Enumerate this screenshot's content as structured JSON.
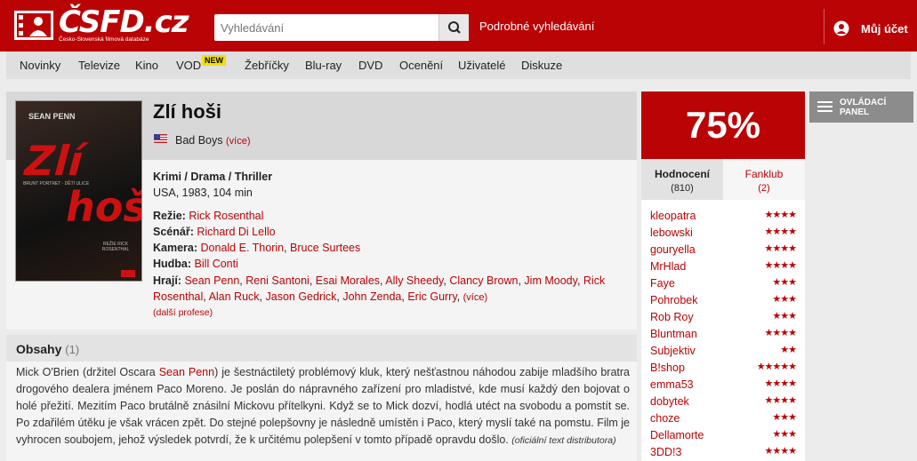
{
  "header": {
    "logo_text": "ČSFD.cz",
    "logo_sub": "Česko-Slovenská filmová databáze",
    "search_placeholder": "Vyhledávání",
    "advanced_search": "Podrobné vyhledávání",
    "account": "Můj účet"
  },
  "nav": {
    "items": [
      "Novinky",
      "Televize",
      "Kino",
      "VOD",
      "Žebříčky",
      "Blu-ray",
      "DVD",
      "Ocenění",
      "Uživatelé",
      "Diskuze"
    ],
    "new_badge": "NEW"
  },
  "film": {
    "poster": {
      "top": "SEAN PENN",
      "title1": "Zlí",
      "title2": "hoši",
      "tagline": "BRUNT PORTRET · DĚTÍ ULICE",
      "credit": "REŽIE RICK ROSENTHAL"
    },
    "title": "Zlí hoši",
    "original_title": "Bad Boys",
    "more": "(více)",
    "genres": "Krimi / Drama / Thriller",
    "origin": "USA, 1983, 104 min",
    "credits": [
      {
        "role": "Režie:",
        "names": [
          "Rick Rosenthal"
        ]
      },
      {
        "role": "Scénář:",
        "names": [
          "Richard Di Lello"
        ]
      },
      {
        "role": "Kamera:",
        "names": [
          "Donald E. Thorin",
          "Bruce Surtees"
        ]
      },
      {
        "role": "Hudba:",
        "names": [
          "Bill Conti"
        ]
      }
    ],
    "cast_label": "Hrají:",
    "cast": [
      "Sean Penn",
      "Reni Santoni",
      "Esai Morales",
      "Ally Sheedy",
      "Clancy Brown",
      "Jim Moody",
      "Rick Rosenthal",
      "Alan Ruck",
      "Jason Gedrick",
      "John Zenda",
      "Eric Gurry"
    ],
    "cast_more": "(více)",
    "more_professions": "(další profese)"
  },
  "plot": {
    "title": "Obsahy",
    "count": "(1)",
    "text_before": "Mick O'Brien (držitel Oscara ",
    "text_link": "Sean Penn",
    "text_after": ") je šestnáctiletý problémový kluk, který nešťastnou náhodou zabije mladšího bratra drogového dealera jménem Paco Moreno. Je poslán do nápravného zařízení pro mladistvé, kde musí každý den bojovat o holé přežití. Mezitím Paco brutálně znásilní Mickovu přítelkyni. Když se to Mick dozví, hodlá utéct na svobodu a pomstít se. Po zdařilém útěku je však vrácen zpět. Do stejné polepšovny je následně umístěn i Paco, který myslí také na pomstu. Film je vyhrocen soubojem, jehož výsledek potvrdí, že k určitému polepšení v tomto případě opravdu došlo.",
    "source": "(oficiální text distributora)"
  },
  "rating": {
    "score": "75%",
    "tab_ratings": "Hodnocení",
    "tab_ratings_count": "(810)",
    "tab_fanclub": "Fanklub",
    "tab_fanclub_count": "(2)",
    "users": [
      {
        "name": "kleopatra",
        "stars": 4
      },
      {
        "name": "lebowski",
        "stars": 4
      },
      {
        "name": "gouryella",
        "stars": 4
      },
      {
        "name": "MrHlad",
        "stars": 4
      },
      {
        "name": "Faye",
        "stars": 3
      },
      {
        "name": "Pohrobek",
        "stars": 3
      },
      {
        "name": "Rob Roy",
        "stars": 3
      },
      {
        "name": "Bluntman",
        "stars": 4
      },
      {
        "name": "Subjektiv",
        "stars": 2
      },
      {
        "name": "B!shop",
        "stars": 5
      },
      {
        "name": "emma53",
        "stars": 4
      },
      {
        "name": "dobytek",
        "stars": 4
      },
      {
        "name": "choze",
        "stars": 3
      },
      {
        "name": "Dellamorte",
        "stars": 3
      },
      {
        "name": "3DD!3",
        "stars": 4
      }
    ]
  },
  "control_panel": {
    "label": "OVLÁDACÍ PANEL"
  },
  "colors": {
    "brand_red": "#ba0305",
    "nav_bg": "#dfdfdf",
    "badge_yellow": "#f3df00"
  }
}
